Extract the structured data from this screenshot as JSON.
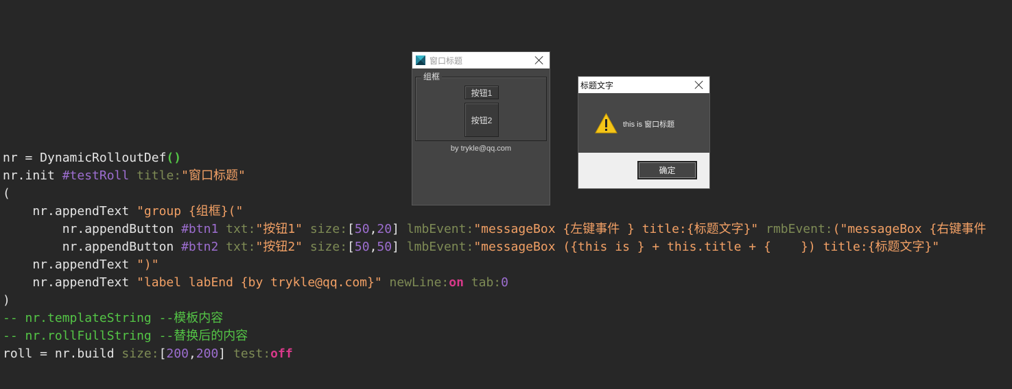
{
  "code_lines": [
    [
      {
        "t": "plain",
        "v": "nr = DynamicRolloutDef"
      },
      {
        "t": "paren",
        "v": "()"
      }
    ],
    [
      {
        "t": "plain",
        "v": "nr.init "
      },
      {
        "t": "name",
        "v": "#testRoll"
      },
      {
        "t": "plain",
        "v": " "
      },
      {
        "t": "key",
        "v": "title:"
      },
      {
        "t": "str",
        "v": "\"窗口标题\""
      }
    ],
    [
      {
        "t": "plain",
        "v": "("
      }
    ],
    [
      {
        "t": "plain",
        "v": "    nr.appendText "
      },
      {
        "t": "str",
        "v": "\"group {组框}(\""
      }
    ],
    [
      {
        "t": "plain",
        "v": "        nr.appendButton "
      },
      {
        "t": "name",
        "v": "#btn1"
      },
      {
        "t": "plain",
        "v": " "
      },
      {
        "t": "key",
        "v": "txt:"
      },
      {
        "t": "str",
        "v": "\"按钮1\""
      },
      {
        "t": "plain",
        "v": " "
      },
      {
        "t": "key",
        "v": "size:"
      },
      {
        "t": "plain",
        "v": "["
      },
      {
        "t": "num",
        "v": "50"
      },
      {
        "t": "plain",
        "v": ","
      },
      {
        "t": "num",
        "v": "20"
      },
      {
        "t": "plain",
        "v": "] "
      },
      {
        "t": "key",
        "v": "lmbEvent:"
      },
      {
        "t": "str",
        "v": "\"messageBox {左键事件 } title:{标题文字}\""
      },
      {
        "t": "plain",
        "v": " "
      },
      {
        "t": "key",
        "v": "rmbEvent:"
      },
      {
        "t": "str",
        "v": "(\"messageBox {右键事件"
      }
    ],
    [
      {
        "t": "plain",
        "v": "        nr.appendButton "
      },
      {
        "t": "name",
        "v": "#btn2"
      },
      {
        "t": "plain",
        "v": " "
      },
      {
        "t": "key",
        "v": "txt:"
      },
      {
        "t": "str",
        "v": "\"按钮2\""
      },
      {
        "t": "plain",
        "v": " "
      },
      {
        "t": "key",
        "v": "size:"
      },
      {
        "t": "plain",
        "v": "["
      },
      {
        "t": "num",
        "v": "50"
      },
      {
        "t": "plain",
        "v": ","
      },
      {
        "t": "num",
        "v": "50"
      },
      {
        "t": "plain",
        "v": "] "
      },
      {
        "t": "key",
        "v": "lmbEvent:"
      },
      {
        "t": "str",
        "v": "\"messageBox ({this is } + this.title + {    }) title:{标题文字}\""
      }
    ],
    [
      {
        "t": "plain",
        "v": "    nr.appendText "
      },
      {
        "t": "str",
        "v": "\")\""
      }
    ],
    [
      {
        "t": "plain",
        "v": "    nr.appendText "
      },
      {
        "t": "str",
        "v": "\"label labEnd {by trykle@qq.com}\""
      },
      {
        "t": "plain",
        "v": " "
      },
      {
        "t": "key",
        "v": "newLine:"
      },
      {
        "t": "bool",
        "v": "on"
      },
      {
        "t": "plain",
        "v": " "
      },
      {
        "t": "key",
        "v": "tab:"
      },
      {
        "t": "num",
        "v": "0"
      }
    ],
    [
      {
        "t": "plain",
        "v": ")"
      }
    ],
    [
      {
        "t": "comment",
        "v": "-- nr.templateString --模板内容"
      }
    ],
    [
      {
        "t": "comment",
        "v": "-- nr.rollFullString --替换后的内容"
      }
    ],
    [
      {
        "t": "plain",
        "v": "roll = nr.build "
      },
      {
        "t": "key",
        "v": "size:"
      },
      {
        "t": "plain",
        "v": "["
      },
      {
        "t": "num",
        "v": "200"
      },
      {
        "t": "plain",
        "v": ","
      },
      {
        "t": "num",
        "v": "200"
      },
      {
        "t": "plain",
        "v": "] "
      },
      {
        "t": "key",
        "v": "test:"
      },
      {
        "t": "bool",
        "v": "off"
      }
    ]
  ],
  "rollout": {
    "title": "窗口标题",
    "app_icon": "3dsmax-icon",
    "close_icon": "close-icon",
    "group_label": "组框",
    "btn1_label": "按钮1",
    "btn2_label": "按钮2",
    "footer_label": "by trykle@qq.com"
  },
  "msgbox": {
    "title": "标题文字",
    "icon": "warning-icon",
    "message": "this is 窗口标题",
    "ok_label": "确定",
    "close_icon": "close-icon"
  },
  "colors": {
    "editor_bg": "#272727",
    "string": "#f2a065",
    "name": "#9d6ed0",
    "keyword": "#7e8b55",
    "bool": "#d9398a",
    "comment": "#54c546",
    "warning": "#f5c518"
  }
}
